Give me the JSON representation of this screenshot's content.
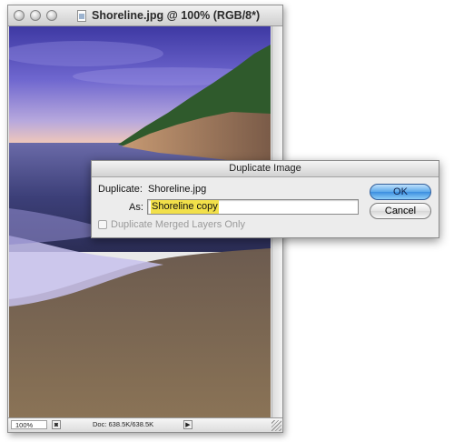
{
  "window": {
    "title": "Shoreline.jpg @ 100% (RGB/8*)"
  },
  "statusbar": {
    "zoom": "100%",
    "doc_size": "Doc: 638.5K/638.5K",
    "menu_arrow": "▶"
  },
  "dialog": {
    "title": "Duplicate Image",
    "duplicate_label": "Duplicate:",
    "duplicate_value": "Shoreline.jpg",
    "as_label": "As:",
    "as_value": "Shoreline copy",
    "merged_layers_label": "Duplicate Merged Layers Only",
    "merged_layers_checked": false,
    "ok_label": "OK",
    "cancel_label": "Cancel"
  },
  "colors": {
    "accent": "#4a9be6",
    "selection": "#f2e04a"
  },
  "icons": [
    "close-icon",
    "minimize-icon",
    "zoom-icon",
    "document-icon",
    "resize-grip-icon"
  ]
}
